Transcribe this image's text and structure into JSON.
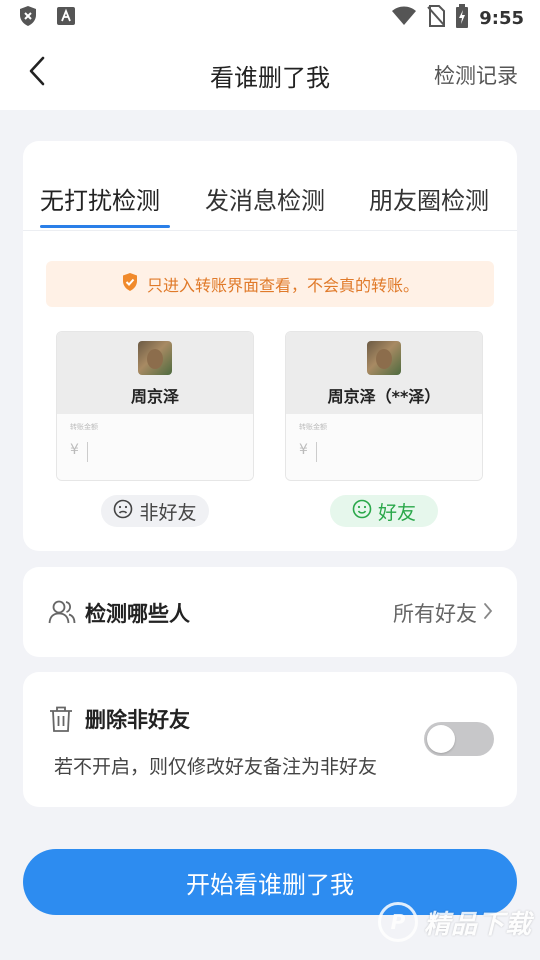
{
  "status_bar": {
    "time": "9:55",
    "icons": [
      "shield-x-icon",
      "a-badge-icon",
      "wifi-icon",
      "no-sim-icon",
      "battery-charging-icon"
    ]
  },
  "nav": {
    "title": "看谁删了我",
    "right_action": "检测记录",
    "back_icon": "chevron-left-icon"
  },
  "tabs": [
    {
      "label": "无打扰检测",
      "active": true
    },
    {
      "label": "发消息检测",
      "active": false
    },
    {
      "label": "朋友圈检测",
      "active": false
    }
  ],
  "notice": {
    "icon": "shield-check-icon",
    "text": "只进入转账界面查看，不会真的转账。",
    "color": "#e07a2a"
  },
  "demos": [
    {
      "name": "周京泽",
      "field_label": "转账金额",
      "currency": "¥",
      "result": "非好友",
      "result_icon": "sad-face-icon"
    },
    {
      "name": "周京泽（**泽）",
      "field_label": "转账金额",
      "currency": "¥",
      "result": "好友",
      "result_icon": "smile-face-icon"
    }
  ],
  "detect_row": {
    "icon": "people-icon",
    "title": "检测哪些人",
    "value": "所有好友"
  },
  "delete_row": {
    "icon": "trash-icon",
    "title": "删除非好友",
    "subtitle": "若不开启，则仅修改好友备注为非好友",
    "toggle_on": false
  },
  "primary_button": {
    "label": "开始看谁删了我",
    "color": "#2d8cf0"
  },
  "watermark": {
    "text": "精品下载"
  }
}
